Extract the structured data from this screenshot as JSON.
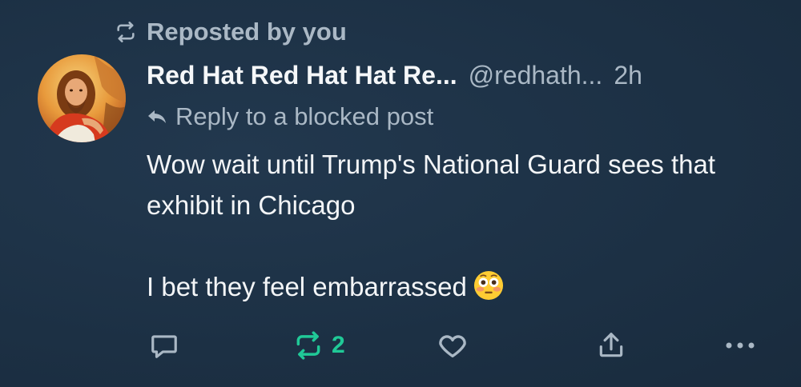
{
  "repost": {
    "label": "Reposted by you",
    "icon": "repost-icon"
  },
  "post": {
    "display_name": "Red Hat Red Hat Hat Re...",
    "handle": "@redhath...",
    "time": "2h",
    "reply_label": "Reply to a blocked post",
    "body": [
      "Wow wait until Trump's National Guard sees that exhibit in Chicago",
      "I bet they feel embarrassed"
    ],
    "emoji": "flushed-face",
    "avatar": "religious-painting-avatar"
  },
  "actions": {
    "reply": {
      "icon": "reply-bubble-icon",
      "count": ""
    },
    "repost": {
      "icon": "repost-icon",
      "count": "2",
      "color": "#20c997"
    },
    "like": {
      "icon": "heart-icon",
      "count": ""
    },
    "share": {
      "icon": "share-icon"
    },
    "more": {
      "icon": "more-icon"
    }
  },
  "colors": {
    "background": "#1e3246",
    "muted_text": "#aab8c5",
    "primary_text": "#f3f5f7",
    "reposted_accent": "#20c997"
  }
}
